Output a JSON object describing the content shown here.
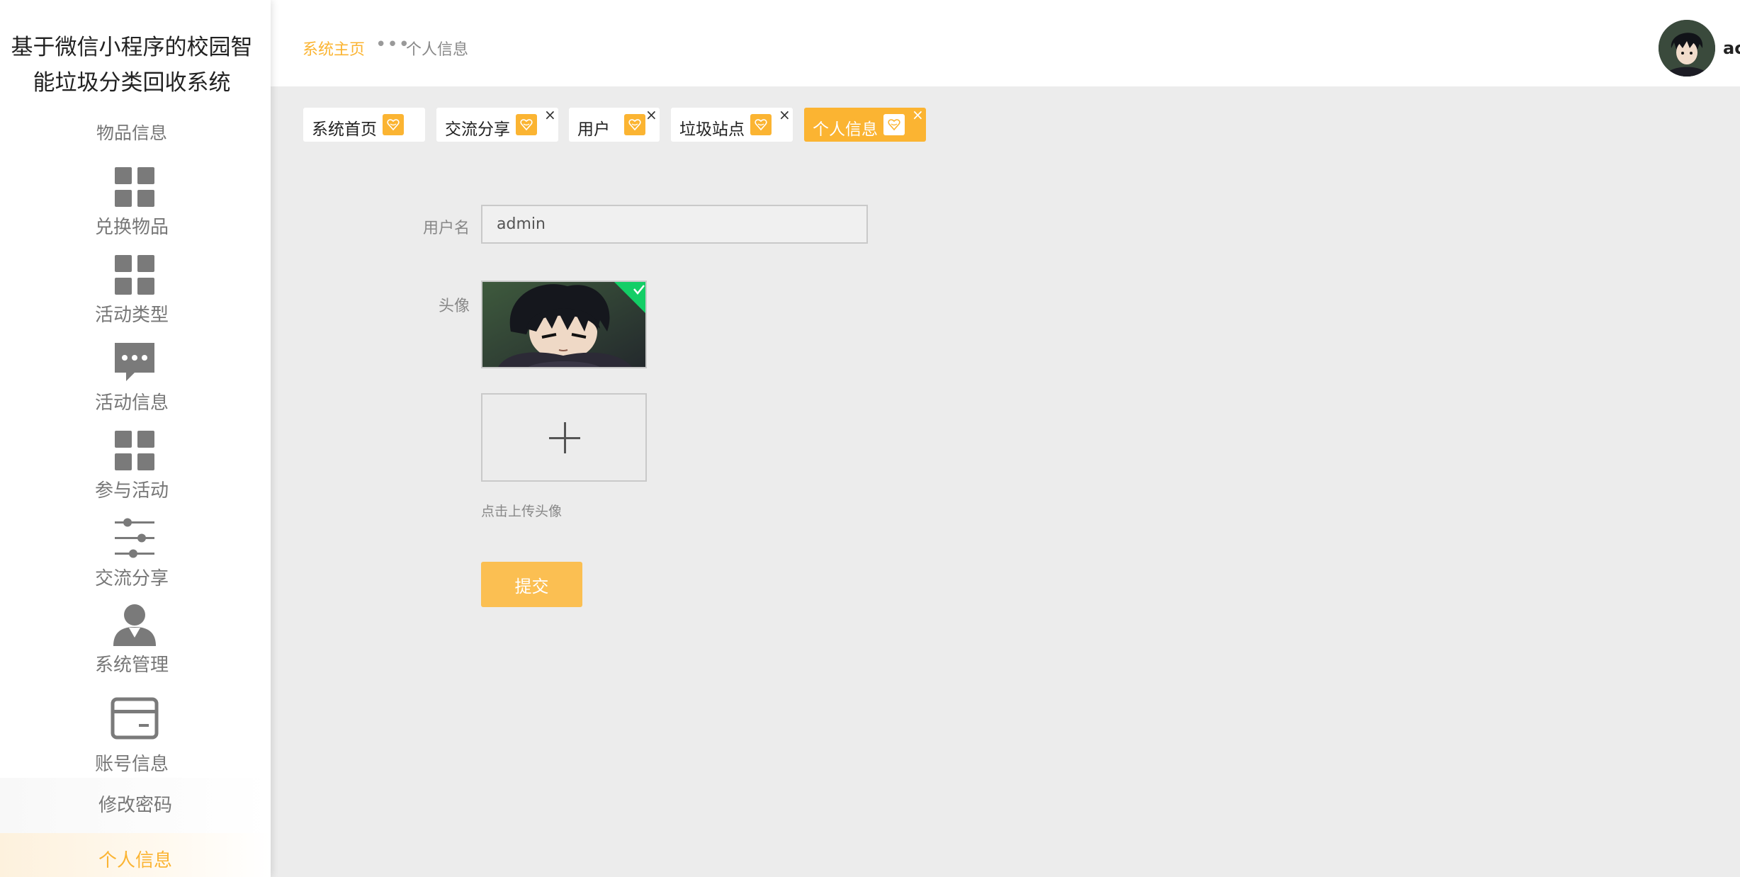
{
  "sidebar": {
    "system_title": "基于微信小程序的校园智能垃圾分类回收系统",
    "cut_item_label": "物品信息",
    "items": [
      {
        "label": "兑换物品",
        "icon": "grid-icon"
      },
      {
        "label": "活动类型",
        "icon": "grid-icon"
      },
      {
        "label": "活动信息",
        "icon": "chat-bubble-icon"
      },
      {
        "label": "参与活动",
        "icon": "grid-icon"
      },
      {
        "label": "交流分享",
        "icon": "sliders-icon"
      },
      {
        "label": "系统管理",
        "icon": "person-icon"
      },
      {
        "label": "账号信息",
        "icon": "card-icon"
      }
    ],
    "sub_items": [
      {
        "label": "修改密码"
      },
      {
        "label": "个人信息",
        "active": true
      }
    ]
  },
  "header": {
    "breadcrumb_home": "系统主页",
    "breadcrumb_sep": "•••",
    "breadcrumb_current": "个人信息",
    "user_name": "ac"
  },
  "tabs": [
    {
      "label": "系统首页",
      "closable": false,
      "active": false
    },
    {
      "label": "交流分享",
      "closable": true,
      "active": false
    },
    {
      "label": "用户",
      "closable": true,
      "active": false
    },
    {
      "label": "垃圾站点",
      "closable": true,
      "active": false
    },
    {
      "label": "个人信息",
      "closable": true,
      "active": true
    }
  ],
  "tab_close_glyph": "×",
  "form": {
    "username_label": "用户名",
    "username_value": "admin",
    "avatar_label": "头像",
    "upload_tip": "点击上传头像",
    "submit_label": "提交"
  },
  "colors": {
    "accent": "#fbb432",
    "background": "#ececec",
    "upload_success": "#13ce66"
  }
}
